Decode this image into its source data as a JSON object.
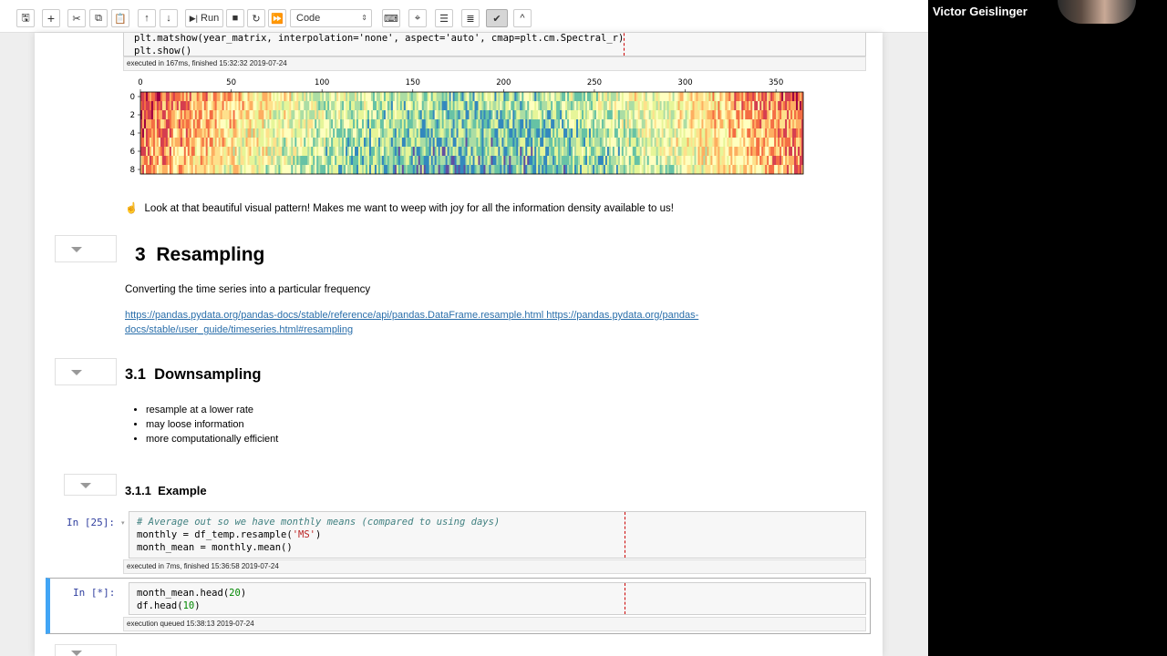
{
  "toolbar": {
    "run_label": "Run",
    "cell_type": "Code"
  },
  "cell_top": {
    "code_lines": [
      "plt.matshow(year_matrix, interpolation='none', aspect='auto', cmap=plt.cm.Spectral_r)",
      "plt.show()"
    ],
    "exec_info": "executed in 167ms, finished 15:32:32 2019-07-24"
  },
  "chart_data": {
    "type": "heatmap",
    "x_ticks": [
      0,
      50,
      100,
      150,
      200,
      250,
      300,
      350
    ],
    "y_ticks": [
      0,
      2,
      4,
      6,
      8
    ],
    "x_range": [
      0,
      365
    ],
    "y_range": [
      0,
      9
    ],
    "colormap": "Spectral_r"
  },
  "md_pattern": {
    "emoji": "☝",
    "text": "Look at that beautiful visual pattern! Makes me want to weep with joy for all the information density available to us!"
  },
  "section3": {
    "number": "3",
    "title": "Resampling",
    "desc": "Converting the time series into a particular frequency",
    "link1": "https://pandas.pydata.org/pandas-docs/stable/reference/api/pandas.DataFrame.resample.html",
    "link2_part1": "https://pandas.pydata.org/pandas-",
    "link2_part2": "docs/stable/user_guide/timeseries.html#resampling"
  },
  "section31": {
    "number": "3.1",
    "title": "Downsampling",
    "bullets": [
      "resample at a lower rate",
      "may loose information",
      "more computationally efficient"
    ]
  },
  "section311": {
    "number": "3.1.1",
    "title": "Example"
  },
  "cell25": {
    "prompt": "In [25]:",
    "exec_info": "executed in 7ms, finished 15:36:58 2019-07-24"
  },
  "cell_star": {
    "prompt": "In [*]:",
    "exec_info": "execution queued 15:38:13 2019-07-24"
  },
  "webcam": {
    "name": "Victor Geislinger"
  }
}
